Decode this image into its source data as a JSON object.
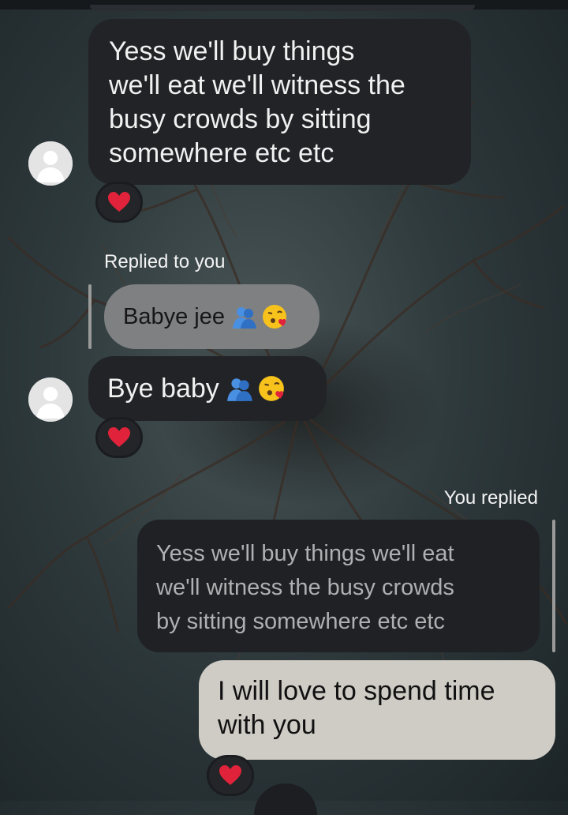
{
  "conversation": {
    "messages": [
      {
        "text": "Yess we'll buy things\nwe'll eat we'll witness the\nbusy crowds by sitting\nsomewhere etc etc",
        "reaction": "heart-icon"
      },
      {
        "reply_label": "Replied to you",
        "quoted_text": "Babye jee"
      },
      {
        "text": "Bye baby",
        "reaction": "heart-icon"
      },
      {
        "reply_label": "You replied",
        "quoted_text": "Yess we'll buy things we'll eat\nwe'll witness the busy crowds\nby sitting somewhere etc etc"
      },
      {
        "text": "I will love to spend time\nwith you",
        "reaction": "heart-icon"
      }
    ]
  },
  "colors": {
    "bubble_incoming": "#212327",
    "bubble_outgoing": "#cfcbc5",
    "bubble_quoted_incoming": "#7f8082",
    "heart": "#e0233a"
  }
}
